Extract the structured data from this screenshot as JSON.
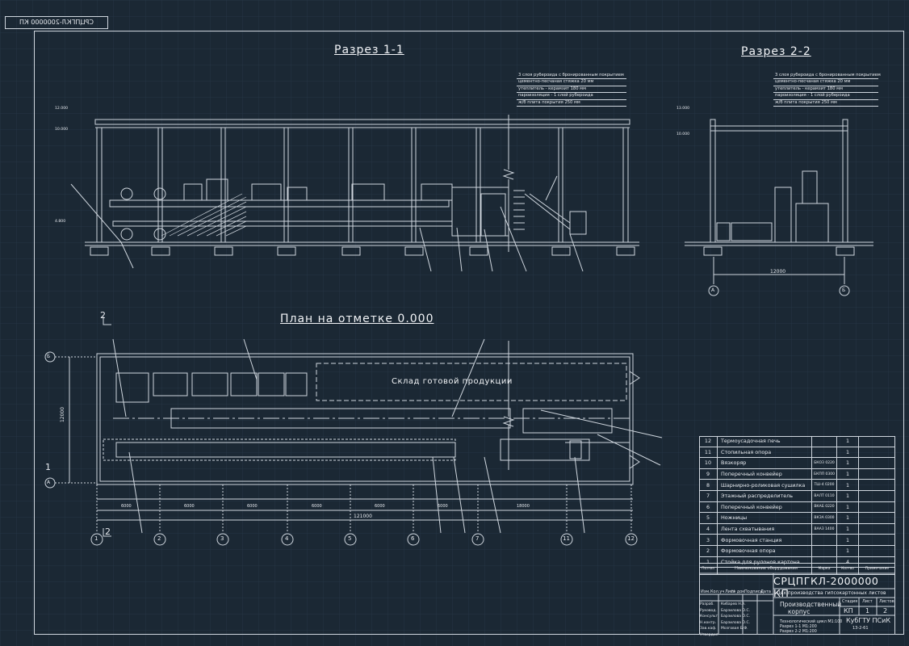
{
  "stamp": "СРЦПГКЛ-2000000 КП",
  "titles": {
    "section1": "Разрез 1-1",
    "section2": "Разрез 2-2",
    "plan": "План на отметке 0.000"
  },
  "warehouse_label": "Склад готовой продукции",
  "roof_notes_1": [
    "3 слоя рубероида с бронированным покрытием",
    "цементно-песчаная стяжка 20 мм",
    "утеплитель - керамзит 180 мм",
    "пароизоляция - 1 слой рубероида",
    "ж/б плита покрытия 250 мм"
  ],
  "roof_notes_2": [
    "3 слоя рубероида с бронированным покрытием",
    "цементно-песчаная стяжка 20 мм",
    "утеплитель - керамзит 180 мм",
    "пароизоляция - 1 слой рубероида",
    "ж/б плита покрытия 250 мм"
  ],
  "elev_left": [
    "12.000",
    "10.000",
    "4.800"
  ],
  "elev_right_top": [
    "13.000",
    "10.000"
  ],
  "dim_span_2": "12000",
  "dim_total_plan": "121000",
  "dim_plan_width": "12000",
  "axis_letters": [
    "А",
    "Б"
  ],
  "axis_numbers": [
    "1",
    "2",
    "3",
    "4",
    "5",
    "6",
    "7",
    "8",
    "9",
    "10",
    "11",
    "12"
  ],
  "plan_axis_labels": [
    "1",
    "2",
    "3",
    "4",
    "5",
    "6",
    "7",
    "8",
    "9",
    "11",
    "12"
  ],
  "plan_dims_bottom": [
    "6000",
    "6000",
    "6000",
    "6000",
    "6000",
    "6000",
    "6000",
    "6000",
    "6000",
    "6000",
    "18000"
  ],
  "section_mark": "2",
  "section_mark_left": "1",
  "spec": {
    "rows": [
      {
        "no": "12",
        "name": "Термоусадочная печь",
        "mark": "",
        "qty": "1"
      },
      {
        "no": "11",
        "name": "Стопильная опора",
        "mark": "",
        "qty": "1"
      },
      {
        "no": "10",
        "name": "Вязкоряр",
        "mark": "БКОЗ 0220",
        "qty": "1"
      },
      {
        "no": "9",
        "name": "Поперечный конвейер",
        "mark": "БКПП 0300",
        "qty": "1"
      },
      {
        "no": "8",
        "name": "Шарнирно-роликовая сушилка",
        "mark": "ТШ-4 0200",
        "qty": "1"
      },
      {
        "no": "7",
        "name": "Этажный распределитель",
        "mark": "ВАЛТ 0110",
        "qty": "1"
      },
      {
        "no": "6",
        "name": "Поперечный конвейер",
        "mark": "ВКАБ 0220",
        "qty": "1"
      },
      {
        "no": "5",
        "name": "Ножницы",
        "mark": "ВКЗА 0300",
        "qty": "1"
      },
      {
        "no": "4",
        "name": "Лента схватывания",
        "mark": "ВААЗ 1400",
        "qty": "1"
      },
      {
        "no": "3",
        "name": "Формовочная станция",
        "mark": "",
        "qty": "1"
      },
      {
        "no": "2",
        "name": "Формовочная опора",
        "mark": "",
        "qty": "1"
      },
      {
        "no": "1",
        "name": "Стойка для рулонов картона",
        "mark": "",
        "qty": "4"
      }
    ],
    "header": {
      "pos": "Поз-ия",
      "name": "Наименование оборудования",
      "mark": "Марка",
      "qty": "Кол-во",
      "note": "Примечание"
    }
  },
  "title_block": {
    "code": "СРЦПГКЛ-2000000 КП",
    "shop": "Цех производства гипсокартонных листов",
    "building": [
      "Производственный",
      "корпус"
    ],
    "sheet_content": [
      "Технологический цикл М1:100",
      "Разрез 1-1 М1:200",
      "Разрез 2-2 М1:200"
    ],
    "stage_labels": [
      "Стадия",
      "Лист",
      "Листов"
    ],
    "stage_values": [
      "КП",
      "1",
      "2"
    ],
    "org": "КубГТУ ПСиК",
    "org_code": "13-2-61",
    "header_cols": [
      "Изм.",
      "Кол.уч",
      "Лист",
      "№ док",
      "Подпись",
      "Дата"
    ],
    "roles": [
      {
        "role": "Разраб.",
        "name": "Кибарев Н.А."
      },
      {
        "role": "Руковод.",
        "name": "Барзилова О.С."
      },
      {
        "role": "Консульт.",
        "name": "Барзилова О.С."
      },
      {
        "role": "Н.контр.",
        "name": "Барзилова О.С."
      },
      {
        "role": "Зав.каф.",
        "name": "Мозговая Б.Ф."
      },
      {
        "role": "Утвердил",
        "name": ""
      }
    ]
  },
  "colors": {
    "background": "#1b2834",
    "lines": "#cfd6de",
    "grid": "#243544"
  }
}
